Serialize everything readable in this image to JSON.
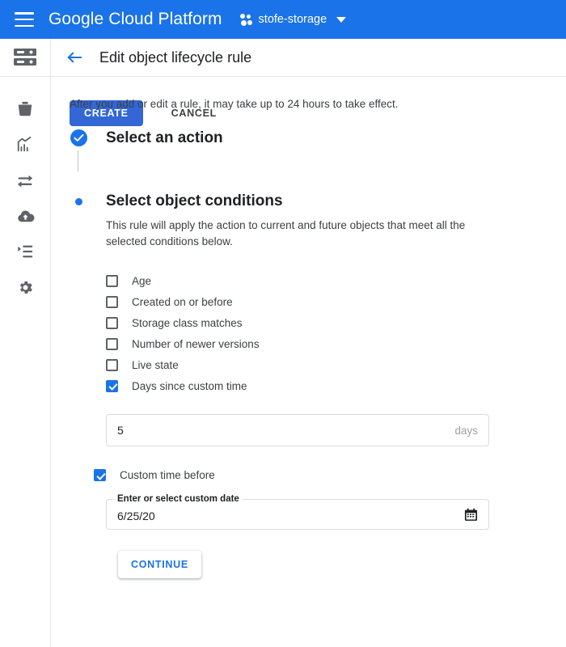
{
  "topbar": {
    "menu_icon": "hamburger-menu-icon",
    "brand": "Google Cloud Platform",
    "project_icon": "project-dots-icon",
    "project_name": "stofe-storage",
    "project_caret": "chevron-down-icon"
  },
  "rail": {
    "items": [
      {
        "icon": "storage-server-icon",
        "name": "cloud-storage"
      },
      {
        "icon": "bucket-icon",
        "name": "browser"
      },
      {
        "icon": "monitoring-chart-icon",
        "name": "monitoring"
      },
      {
        "icon": "transfer-arrows-icon",
        "name": "transfer"
      },
      {
        "icon": "cloud-upload-icon",
        "name": "transfer-appliance"
      },
      {
        "icon": "list-logs-icon",
        "name": "settings-list"
      },
      {
        "icon": "gear-icon",
        "name": "settings"
      }
    ]
  },
  "header": {
    "back_icon": "back-arrow-icon",
    "title": "Edit object lifecycle rule"
  },
  "content": {
    "notice": "After you add or edit a rule, it may take up to 24 hours to take effect.",
    "step1": {
      "title": "Select an action",
      "marker": "check-circle-icon"
    },
    "step2": {
      "title": "Select object conditions",
      "marker": "active-dot-icon",
      "description": "This rule will apply the action to current and future objects that meet all the selected conditions below."
    },
    "conditions": [
      {
        "label": "Age",
        "checked": false
      },
      {
        "label": "Created on or before",
        "checked": false
      },
      {
        "label": "Storage class matches",
        "checked": false
      },
      {
        "label": "Number of newer versions",
        "checked": false
      },
      {
        "label": "Live state",
        "checked": false
      },
      {
        "label": "Days since custom time",
        "checked": true
      }
    ],
    "days_field": {
      "value": "5",
      "suffix": "days"
    },
    "custom_time_before": {
      "label": "Custom time before",
      "checked": true
    },
    "date_field": {
      "legend": "Enter or select custom date",
      "value": "6/25/20",
      "icon": "calendar-icon"
    },
    "buttons": {
      "continue": "CONTINUE",
      "create": "CREATE",
      "cancel": "CANCEL"
    }
  },
  "colors": {
    "brand_blue": "#1a73e8",
    "create_blue": "#3367d6",
    "text_primary": "#202124",
    "text_secondary": "#3c4043",
    "muted": "#9aa0a6",
    "border": "#dadce0"
  }
}
